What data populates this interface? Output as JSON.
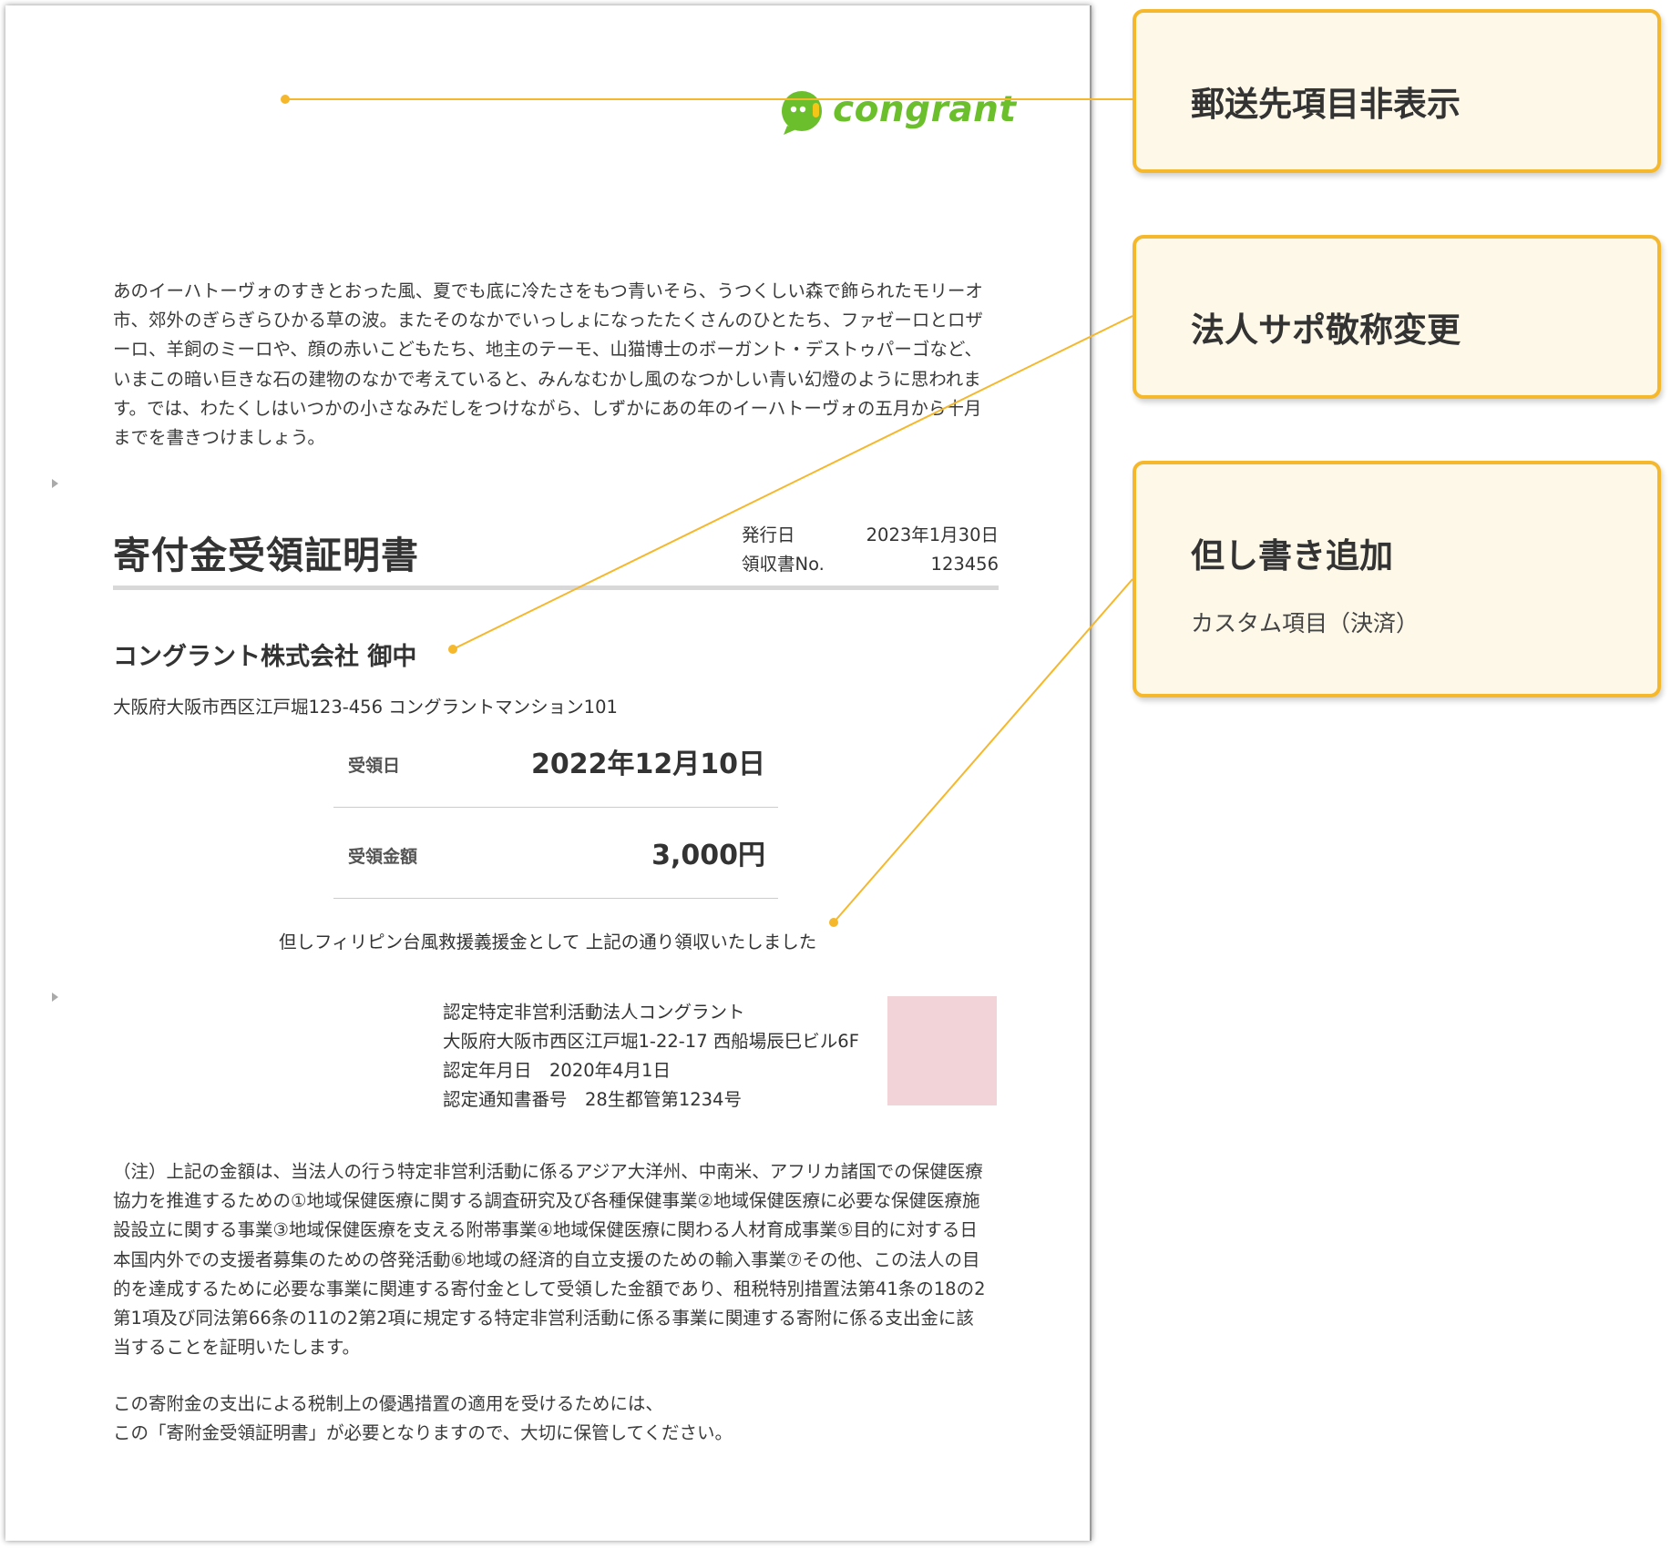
{
  "logo": {
    "text": "congrant",
    "brand_color": "#6cbf2c"
  },
  "intro_text": "あのイーハトーヴォのすきとおった風、夏でも底に冷たさをもつ青いそら、うつくしい森で飾られたモリーオ市、郊外のぎらぎらひかる草の波。またそのなかでいっしょになったたくさんのひとたち、ファゼーロとロザーロ、羊飼のミーロや、顔の赤いこどもたち、地主のテーモ、山猫博士のボーガント・デストゥパーゴなど、いまこの暗い巨きな石の建物のなかで考えていると、みんなむかし風のなつかしい青い幻燈のように思われます。では、わたくしはいつかの小さなみだしをつけながら、しずかにあの年のイーハトーヴォの五月から十月までを書きつけましょう。",
  "document": {
    "title": "寄付金受領証明書",
    "meta": [
      {
        "label": "発行日",
        "value": "2023年1月30日"
      },
      {
        "label": "領収書No.",
        "value": "123456"
      }
    ],
    "recipient": "コングラント株式会社 御中",
    "recipient_address": "大阪府大阪市西区江戸堀123-456 コングラントマンション101",
    "fields": [
      {
        "label": "受領日",
        "value": "2022年12月10日"
      },
      {
        "label": "受領金額",
        "value": "3,000円"
      }
    ],
    "tadashi": "但しフィリピン台風救援義援金として 上記の通り領収いたしました",
    "issuer": {
      "name": "認定特定非営利活動法人コングラント",
      "address": "大阪府大阪市西区江戸堀1-22-17 西船場辰巳ビル6F",
      "cert_date": "認定年月日　2020年4月1日",
      "cert_no": "認定通知書番号　28生都管第1234号"
    },
    "note": "（注）上記の金額は、当法人の行う特定非営利活動に係るアジア大洋州、中南米、アフリカ諸国での保健医療協力を推進するための①地域保健医療に関する調査研究及び各種保健事業②地域保健医療に必要な保健医療施設設立に関する事業③地域保健医療を支える附帯事業④地域保健医療に関わる人材育成事業⑤目的に対する日本国内外での支援者募集のための啓発活動⑥地域の経済的自立支援のための輸入事業⑦その他、この法人の目的を達成するために必要な事業に関連する寄付金として受領した金額であり、租税特別措置法第41条の18の2第1項及び同法第66条の11の2第2項に規定する特定非営利活動に係る事業に関連する寄附に係る支出金に該当することを証明いたします。",
    "footer_line1": "この寄附金の支出による税制上の優遇措置の適用を受けるためには、",
    "footer_line2": "この「寄附金受領証明書」が必要となりますので、大切に保管してください。",
    "seal_color": "#f2d3d8"
  },
  "callouts": [
    {
      "title": "郵送先項目非表示"
    },
    {
      "title": "法人サポ敬称変更"
    },
    {
      "title": "但し書き追加",
      "subtitle": "カスタム項目（決済）"
    }
  ],
  "accent_color": "#f5b72c"
}
